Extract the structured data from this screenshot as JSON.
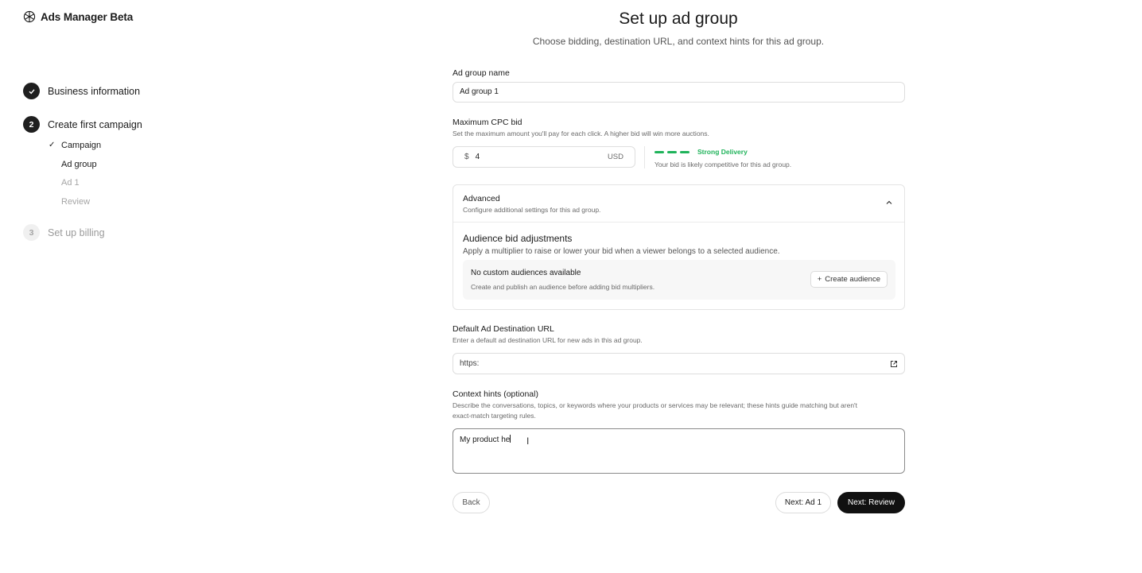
{
  "app": {
    "title": "Ads Manager Beta"
  },
  "sidebar": {
    "steps": [
      {
        "number": "",
        "label": "Business information",
        "status": "done"
      },
      {
        "number": "2",
        "label": "Create first campaign",
        "status": "active",
        "substeps": [
          {
            "label": "Campaign",
            "status": "done"
          },
          {
            "label": "Ad group",
            "status": "current"
          },
          {
            "label": "Ad 1",
            "status": "pending"
          },
          {
            "label": "Review",
            "status": "pending"
          }
        ]
      },
      {
        "number": "3",
        "label": "Set up billing",
        "status": "pending"
      }
    ]
  },
  "header": {
    "title": "Set up ad group",
    "subtitle": "Choose bidding, destination URL, and context hints for this ad group."
  },
  "form": {
    "ad_group_name": {
      "label": "Ad group name",
      "value": "Ad group 1"
    },
    "max_cpc": {
      "label": "Maximum CPC bid",
      "help": "Set the maximum amount you'll pay for each click. A higher bid will win more auctions.",
      "currency_symbol": "$",
      "value": "4",
      "unit": "USD",
      "strength_label": "Strong Delivery",
      "strength_help": "Your bid is likely competitive for this ad group.",
      "strength_color": "#1fb35a"
    },
    "advanced": {
      "title": "Advanced",
      "subtitle": "Configure additional settings for this ad group.",
      "audience_title": "Audience bid adjustments",
      "audience_subtitle": "Apply a multiplier to raise or lower your bid when a viewer belongs to a selected audience.",
      "empty_title": "No custom audiences available",
      "empty_subtitle": "Create and publish an audience before adding bid multipliers.",
      "create_label": "Create audience"
    },
    "destination_url": {
      "label": "Default Ad Destination URL",
      "help": "Enter a default ad destination URL for new ads in this ad group.",
      "value": "https:"
    },
    "context_hints": {
      "label": "Context hints (optional)",
      "help_line1": "Describe the conversations, topics, or keywords where your products or services may be relevant; these hints guide matching but aren't",
      "help_line2": "exact-match targeting rules.",
      "value": "My product he"
    }
  },
  "footer": {
    "back_label": "Back",
    "next_ad_label": "Next: Ad 1",
    "next_review_label": "Next: Review"
  }
}
